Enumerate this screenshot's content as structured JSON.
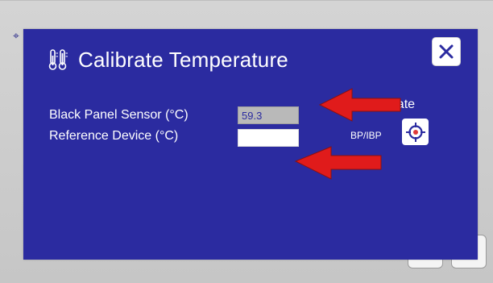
{
  "dialog": {
    "title": "Calibrate Temperature",
    "title_icon": "thermometer-icon",
    "close_icon": "close-icon"
  },
  "fields": {
    "black_panel_label": "Black Panel Sensor (°C)",
    "black_panel_value": "59.3",
    "reference_label": "Reference Device (°C)",
    "reference_value": ""
  },
  "calibrate": {
    "title": "Calibrate",
    "mode_label": "BP/IBP",
    "button_icon": "crosshair-target-icon"
  },
  "colors": {
    "dialog_bg": "#2b2ba0",
    "annotation_arrow": "#e01b1b",
    "screen_bg": "#c9c9c9"
  }
}
